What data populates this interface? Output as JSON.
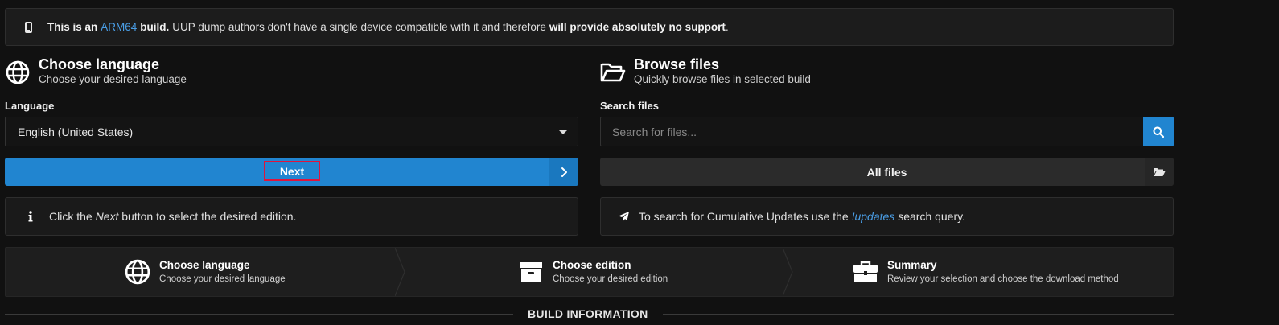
{
  "warning": {
    "icon": "mobile-phone-icon",
    "prefix": "This is an",
    "arch": "ARM64",
    "bold_mid": "build.",
    "text": "UUP dump authors don't have a single device compatible with it and therefore",
    "bold_end": "will provide absolutely no support",
    "period": "."
  },
  "language_section": {
    "title": "Choose language",
    "subtitle": "Choose your desired language",
    "label": "Language",
    "selected": "English (United States)",
    "next_label": "Next",
    "hint_prefix": "Click the",
    "hint_em": "Next",
    "hint_suffix": "button to select the desired edition."
  },
  "browse_section": {
    "title": "Browse files",
    "subtitle": "Quickly browse files in selected build",
    "label": "Search files",
    "search_placeholder": "Search for files...",
    "all_files_label": "All files",
    "hint_prefix": "To search for Cumulative Updates use the",
    "hint_link": "!updates",
    "hint_suffix": "search query."
  },
  "steps": [
    {
      "title": "Choose language",
      "subtitle": "Choose your desired language",
      "icon": "globe-icon"
    },
    {
      "title": "Choose edition",
      "subtitle": "Choose your desired edition",
      "icon": "archive-box-icon"
    },
    {
      "title": "Summary",
      "subtitle": "Review your selection and choose the download method",
      "icon": "briefcase-icon"
    }
  ],
  "build_info_heading": "BUILD INFORMATION",
  "colors": {
    "accent": "#2185d0",
    "link": "#4a9ee6",
    "highlight_border": "#e0143c"
  }
}
